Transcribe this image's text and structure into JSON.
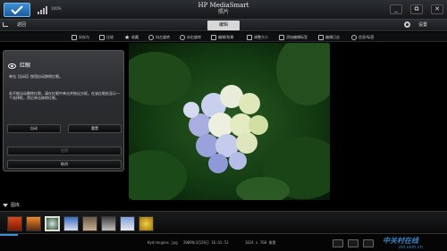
{
  "app": {
    "title": "HP MediaSmart",
    "subtitle": "照片",
    "battery_text": "100%"
  },
  "window": {
    "minimize": "_",
    "restore": "⧉",
    "close": "✕"
  },
  "nav": {
    "back_label": "返回",
    "active_tab": "编辑",
    "settings_label": "设置"
  },
  "toolbar": {
    "items": [
      {
        "label": "另存为",
        "icon": "save-icon"
      },
      {
        "label": "比较",
        "icon": "compare-icon"
      },
      {
        "label": "收藏",
        "icon": "star-icon"
      },
      {
        "label": "向左旋转",
        "icon": "rotate-left-icon"
      },
      {
        "label": "向右旋转",
        "icon": "rotate-right-icon"
      },
      {
        "label": "编辑/效果",
        "icon": "edit-icon"
      },
      {
        "label": "调整大小",
        "icon": "resize-icon"
      },
      {
        "label": "添加编辑标签",
        "icon": "tag-icon"
      },
      {
        "label": "编辑日志",
        "icon": "log-icon"
      },
      {
        "label": "信息/标签",
        "icon": "info-icon"
      }
    ]
  },
  "panel": {
    "heading": "红眼",
    "desc1": "单击【自动】按钮自动移除红眼。",
    "desc2": "若不能自动删除红眼，请在红眼中单击并拖出方框。在该红眼处显示一个选择框，然后单击移除红眼。",
    "auto_button": "自动",
    "reset_button": "重置",
    "apply_button": "应用",
    "cancel_button": "取消"
  },
  "filmstrip": {
    "label": "图库",
    "selected_index": 2
  },
  "status": {
    "filename": "Hydrangeas.jpg",
    "datetime": "2009年3月26日  16:41:53",
    "dimensions": "1024 x 768 像素"
  },
  "watermark": {
    "line1": "中关村在线",
    "line2": "zol.com.cn"
  },
  "colors": {
    "accent": "#3a8fe0",
    "tab_bg": "#d8d8d8"
  }
}
